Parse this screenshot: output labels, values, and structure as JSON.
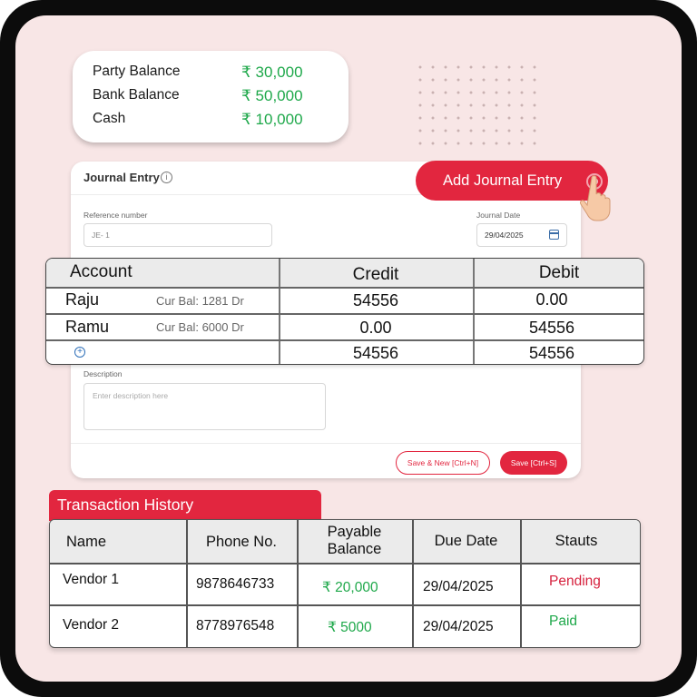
{
  "balances": [
    {
      "label": "Party Balance",
      "value": "₹ 30,000"
    },
    {
      "label": "Bank Balance",
      "value": "₹ 50,000"
    },
    {
      "label": "Cash",
      "value": "₹ 10,000"
    }
  ],
  "journal": {
    "title": "Journal Entry",
    "add_button": "Add Journal Entry",
    "reference_label": "Reference number",
    "reference_value": "JE- 1",
    "date_label": "Journal Date",
    "date_value": "29/04/2025",
    "description_label": "Description",
    "description_placeholder": "Enter description here",
    "save_new_label": "Save & New [Ctrl+N]",
    "save_label": "Save [Ctrl+S]"
  },
  "account_table": {
    "headers": [
      "Account",
      "Credit",
      "Debit"
    ],
    "rows": [
      {
        "account": "Raju",
        "cur_bal": "Cur Bal: 1281 Dr",
        "credit": "54556",
        "debit": "0.00"
      },
      {
        "account": "Ramu",
        "cur_bal": "Cur Bal: 6000 Dr",
        "credit": "0.00",
        "debit": "54556"
      }
    ],
    "totals": {
      "credit": "54556",
      "debit": "54556"
    }
  },
  "transactions": {
    "title": "Transaction History",
    "headers": [
      "Name",
      "Phone No.",
      "Payable\nBalance",
      "Due Date",
      "Stauts"
    ],
    "rows": [
      {
        "name": "Vendor 1",
        "phone": "9878646733",
        "balance": "₹ 20,000",
        "due": "29/04/2025",
        "status": "Pending"
      },
      {
        "name": "Vendor 2",
        "phone": "8778976548",
        "balance": "₹ 5000",
        "due": "29/04/2025",
        "status": "Paid"
      }
    ]
  },
  "colors": {
    "accent": "#e2263f",
    "positive": "#1ea84a",
    "background": "#f8e6e6"
  }
}
